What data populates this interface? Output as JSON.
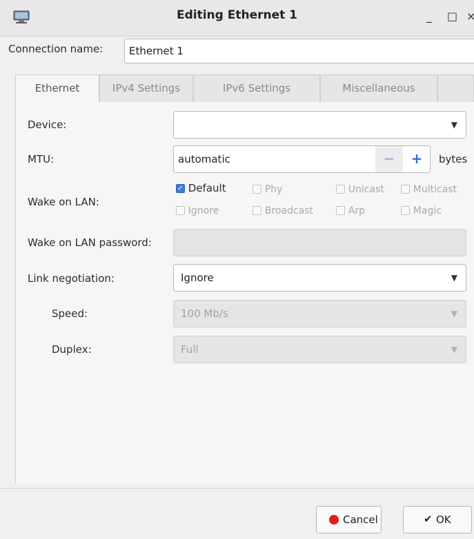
{
  "window": {
    "title": "Editing Ethernet 1",
    "minimize_glyph": "_",
    "maximize_glyph": "□",
    "close_glyph": "×"
  },
  "connection": {
    "label": "Connection name:",
    "value": "Ethernet 1"
  },
  "tabs": [
    {
      "label": "Ethernet",
      "active": true
    },
    {
      "label": "IPv4 Settings",
      "active": false
    },
    {
      "label": "IPv6 Settings",
      "active": false
    },
    {
      "label": "Miscellaneous",
      "active": false
    }
  ],
  "ethernet": {
    "device": {
      "label": "Device:",
      "value": ""
    },
    "mtu": {
      "label": "MTU:",
      "value": "automatic",
      "unit": "bytes"
    },
    "wake_on_lan": {
      "label": "Wake on LAN:",
      "options": [
        {
          "label": "Default",
          "checked": true
        },
        {
          "label": "Phy",
          "checked": false
        },
        {
          "label": "Unicast",
          "checked": false
        },
        {
          "label": "Multicast",
          "checked": false
        },
        {
          "label": "Ignore",
          "checked": false
        },
        {
          "label": "Broadcast",
          "checked": false
        },
        {
          "label": "Arp",
          "checked": false
        },
        {
          "label": "Magic",
          "checked": false
        }
      ]
    },
    "wol_password": {
      "label": "Wake on LAN password:",
      "value": ""
    },
    "link_negotiation": {
      "label": "Link negotiation:",
      "value": "Ignore"
    },
    "speed": {
      "label": "Speed:",
      "value": "100 Mb/s"
    },
    "duplex": {
      "label": "Duplex:",
      "value": "Full"
    }
  },
  "buttons": {
    "cancel": "Cancel",
    "ok": "OK",
    "ok_glyph": "✔"
  },
  "colors": {
    "accent": "#3b7bd6",
    "cancel_icon": "#e0201b"
  }
}
